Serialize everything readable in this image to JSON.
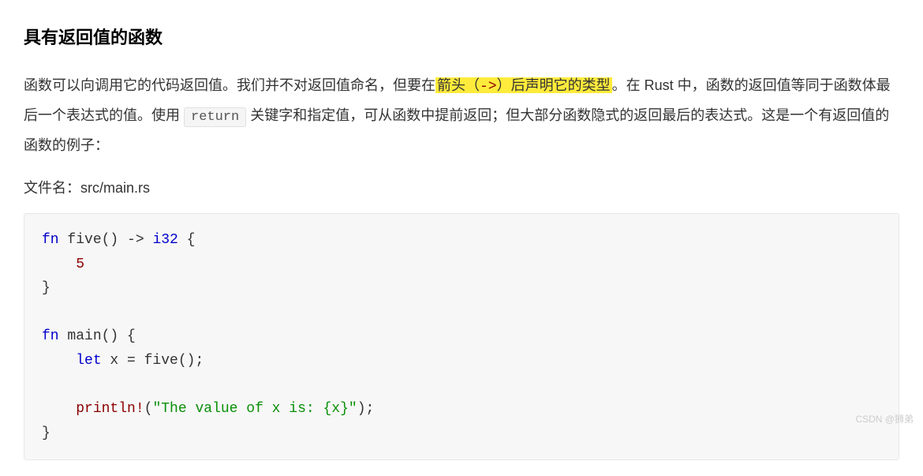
{
  "heading": "具有返回值的函数",
  "paragraph": {
    "p1": "函数可以向调用它的代码返回值。我们并不对返回值命名，但要在",
    "hl_prefix": "箭头（",
    "hl_arrow": "->",
    "hl_suffix": "）后声明它的类型",
    "p2": "。在 Rust 中，函数的返回值等同于函数体最后一个表达式的值。使用 ",
    "inline_code": "return",
    "p3": " 关键字和指定值，可从函数中提前返回；但大部分函数隐式的返回最后的表达式。这是一个有返回值的函数的例子："
  },
  "filename": "文件名：src/main.rs",
  "code": {
    "kw_fn1": "fn",
    "name_five": " five() ",
    "arrow": "->",
    "sp": " ",
    "type_i32": "i32",
    "brace_open1": " {",
    "indent1": "    ",
    "val_5": "5",
    "brace_close1": "}",
    "blank": "",
    "kw_fn2": "fn",
    "name_main": " main() {",
    "kw_let": "let",
    "let_rest": " x = five();",
    "macro_println": "println!",
    "paren_open": "(",
    "str_lit": "\"The value of x is: {x}\"",
    "paren_close": ");",
    "brace_close2": "}"
  },
  "watermark": "CSDN @狮弟"
}
